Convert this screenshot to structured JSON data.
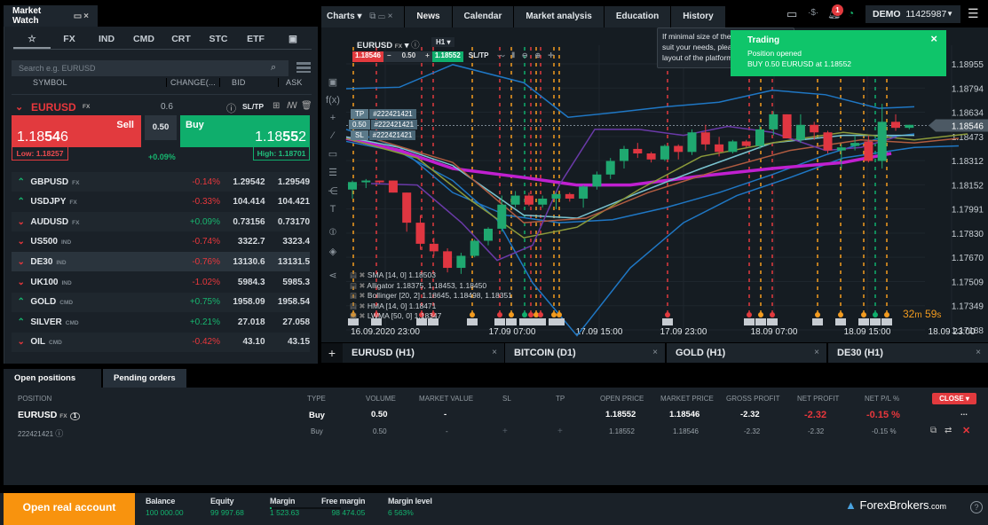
{
  "market_watch": {
    "title": "Market Watch",
    "categories": [
      "☆",
      "FX",
      "IND",
      "CMD",
      "CRT",
      "STC",
      "ETF",
      "▣"
    ],
    "search_placeholder": "Search e.g. EURUSD",
    "columns": {
      "symbol": "SYMBOL",
      "change": "CHANGE(...",
      "bid": "BID",
      "ask": "ASK"
    },
    "selected": {
      "symbol": "EURUSD",
      "tag": "FX",
      "spread": "0.6",
      "sltp": "SL/TP",
      "sell_label": "Sell",
      "sell_price_a": "1.18",
      "sell_price_b": "54",
      "sell_price_c": "6",
      "buy_label": "Buy",
      "buy_price_a": "1.18",
      "buy_price_b": "55",
      "buy_price_c": "2",
      "volume": "0.50",
      "low": "Low: 1.18257",
      "high": "High: 1.18701",
      "change": "+0.09%"
    },
    "rows": [
      {
        "dir": "up",
        "symbol": "GBPUSD",
        "tag": "FX",
        "change": "-0.14%",
        "bid": "1.29542",
        "ask": "1.29549"
      },
      {
        "dir": "up",
        "symbol": "USDJPY",
        "tag": "FX",
        "change": "-0.33%",
        "bid": "104.414",
        "ask": "104.421"
      },
      {
        "dir": "down",
        "symbol": "AUDUSD",
        "tag": "FX",
        "change": "+0.09%",
        "bid": "0.73156",
        "ask": "0.73170"
      },
      {
        "dir": "down",
        "symbol": "US500",
        "tag": "IND",
        "change": "-0.74%",
        "bid": "3322.7",
        "ask": "3323.4"
      },
      {
        "dir": "down",
        "symbol": "DE30",
        "tag": "IND",
        "change": "-0.76%",
        "bid": "13130.6",
        "ask": "13131.5"
      },
      {
        "dir": "down",
        "symbol": "UK100",
        "tag": "IND",
        "change": "-1.02%",
        "bid": "5984.3",
        "ask": "5985.3"
      },
      {
        "dir": "up",
        "symbol": "GOLD",
        "tag": "CMD",
        "change": "+0.75%",
        "bid": "1958.09",
        "ask": "1958.54"
      },
      {
        "dir": "up",
        "symbol": "SILVER",
        "tag": "CMD",
        "change": "+0.21%",
        "bid": "27.018",
        "ask": "27.058"
      },
      {
        "dir": "down",
        "symbol": "OIL",
        "tag": "CMD",
        "change": "-0.42%",
        "bid": "43.10",
        "ask": "43.15"
      }
    ]
  },
  "top_tabs": [
    "Charts",
    "News",
    "Calendar",
    "Market analysis",
    "Education",
    "History"
  ],
  "account": {
    "mode": "DEMO",
    "number": "11425987",
    "notifications": "1"
  },
  "tooltip": {
    "line1": "If minimal size of the",
    "line2": "suit your needs, pleas",
    "line3": "layout of the platform"
  },
  "notification": {
    "title": "Trading",
    "line1": "Position opened",
    "line2": "BUY 0.50 EURUSD at 1.18552",
    "close": "×"
  },
  "chart_toolbar": {
    "symbol": "EURUSD",
    "tag": "FX",
    "timeframe": "H1",
    "sell": "1.18546",
    "volume": "0.50",
    "buy": "1.18552",
    "sltp": "SL/TP"
  },
  "order_labels": {
    "tp": "TP",
    "sl": "SL",
    "volume": "0.50",
    "id": "#222421421"
  },
  "indicators": [
    "SMA [14, 0] 1.18503",
    "Alligator 1.18375, 1.18453, 1.18450",
    "Bollinger [20, 2] 1.18645, 1.18498, 1.18351",
    "HMA [14, 0] 1.18471",
    "LWMA [50, 0] 1.18347"
  ],
  "countdown": {
    "min": "32",
    "min_unit": "m",
    "sec": "59",
    "sec_unit": "s"
  },
  "chart_data": {
    "type": "candlestick",
    "symbol": "EURUSD",
    "timeframe": "H1",
    "y_ticks": [
      "1.18955",
      "1.18794",
      "1.18634",
      "1.18473",
      "1.18312",
      "1.18152",
      "1.17991",
      "1.17830",
      "1.17670",
      "1.17509",
      "1.17349",
      "1.17188"
    ],
    "ylim": [
      1.17188,
      1.18955
    ],
    "current_price": "1.18546",
    "x_ticks": [
      "16.09.2020 23:00",
      "17.09 07:00",
      "17.09 15:00",
      "17.09 23:00",
      "18.09 07:00",
      "18.09 15:00",
      "18.09 23:00"
    ],
    "candles": [
      [
        1.1812,
        1.1818,
        1.1806,
        1.1817
      ],
      [
        1.1818,
        1.1819,
        1.1813,
        1.1818
      ],
      [
        1.1818,
        1.1818,
        1.1816,
        1.1817
      ],
      [
        1.1818,
        1.1818,
        1.181,
        1.181
      ],
      [
        1.181,
        1.181,
        1.1784,
        1.179
      ],
      [
        1.179,
        1.1795,
        1.1772,
        1.1776
      ],
      [
        1.1776,
        1.178,
        1.1768,
        1.1771
      ],
      [
        1.1771,
        1.1773,
        1.1757,
        1.176
      ],
      [
        1.176,
        1.177,
        1.1756,
        1.1768
      ],
      [
        1.1768,
        1.1779,
        1.1767,
        1.1778
      ],
      [
        1.1778,
        1.1787,
        1.1775,
        1.1786
      ],
      [
        1.1786,
        1.1808,
        1.1784,
        1.1802
      ],
      [
        1.1802,
        1.1811,
        1.18,
        1.1808
      ],
      [
        1.1808,
        1.181,
        1.1801,
        1.1802
      ],
      [
        1.1802,
        1.1808,
        1.18,
        1.1806
      ],
      [
        1.1806,
        1.181,
        1.1799,
        1.1809
      ],
      [
        1.1809,
        1.181,
        1.1804,
        1.1806
      ],
      [
        1.1806,
        1.1815,
        1.18,
        1.1814
      ],
      [
        1.1814,
        1.1824,
        1.1812,
        1.1822
      ],
      [
        1.1822,
        1.1833,
        1.1819,
        1.1831
      ],
      [
        1.1831,
        1.1841,
        1.1826,
        1.1839
      ],
      [
        1.1839,
        1.1843,
        1.1833,
        1.1836
      ],
      [
        1.1836,
        1.1837,
        1.183,
        1.1832
      ],
      [
        1.1832,
        1.1842,
        1.1831,
        1.1841
      ],
      [
        1.1841,
        1.1842,
        1.1832,
        1.1837
      ],
      [
        1.1837,
        1.1852,
        1.1835,
        1.185
      ],
      [
        1.185,
        1.1855,
        1.1838,
        1.1842
      ],
      [
        1.1842,
        1.1847,
        1.1834,
        1.1837
      ],
      [
        1.1837,
        1.1845,
        1.1836,
        1.1844
      ],
      [
        1.1844,
        1.1845,
        1.184,
        1.1841
      ],
      [
        1.1841,
        1.1855,
        1.1839,
        1.1852
      ],
      [
        1.1852,
        1.1864,
        1.1848,
        1.1862
      ],
      [
        1.1862,
        1.1862,
        1.1846,
        1.1846
      ],
      [
        1.1845,
        1.1862,
        1.1843,
        1.1855
      ],
      [
        1.1855,
        1.1857,
        1.1845,
        1.185
      ],
      [
        1.185,
        1.1851,
        1.1836,
        1.1838
      ],
      [
        1.1838,
        1.1842,
        1.1826,
        1.184
      ],
      [
        1.1841,
        1.1848,
        1.1838,
        1.1843
      ],
      [
        1.1844,
        1.1848,
        1.183,
        1.1831
      ],
      [
        1.1831,
        1.1869,
        1.1826,
        1.1857
      ],
      [
        1.1857,
        1.1862,
        1.1851,
        1.1853
      ],
      [
        1.1853,
        1.1855,
        1.1852,
        1.1855
      ]
    ]
  },
  "chart_tabs": [
    {
      "label": "EURUSD (H1)"
    },
    {
      "label": "BITCOIN (D1)"
    },
    {
      "label": "GOLD (H1)"
    },
    {
      "label": "DE30 (H1)"
    }
  ],
  "positions": {
    "tab_open": "Open positions",
    "tab_pending": "Pending orders",
    "headers": {
      "position": "POSITION",
      "type": "TYPE",
      "volume": "VOLUME",
      "market_value": "MARKET VALUE",
      "sl": "SL",
      "tp": "TP",
      "open_price": "OPEN PRICE",
      "market_price": "MARKET PRICE",
      "gross_profit": "GROSS PROFIT",
      "net_profit": "NET PROFIT",
      "net_pl": "NET P/L %"
    },
    "close_label": "CLOSE",
    "summary": {
      "symbol": "EURUSD",
      "tag": "FX",
      "count": "1",
      "type": "Buy",
      "volume": "0.50",
      "market_value": "-",
      "open_price": "1.18552",
      "market_price": "1.18546",
      "gross_profit": "-2.32",
      "net_profit": "-2.32",
      "net_pl": "-0.15 %",
      "more": "..."
    },
    "detail": {
      "id": "222421421",
      "type": "Buy",
      "volume": "0.50",
      "market_value": "-",
      "sl": "+",
      "tp": "+",
      "open_price": "1.18552",
      "market_price": "1.18546",
      "gross_profit": "-2.32",
      "net_profit": "-2.32",
      "net_pl": "-0.15 %"
    }
  },
  "footer": {
    "open_real": "Open real account",
    "stats": [
      {
        "label": "Balance",
        "value": "100 000.00"
      },
      {
        "label": "Equity",
        "value": "99 997.68"
      },
      {
        "label": "Margin",
        "value": "1 523.63"
      },
      {
        "label": "Free margin",
        "value": "98 474.05"
      },
      {
        "label": "Margin level",
        "value": "6 563%"
      }
    ],
    "watermark": "ForexBrokers",
    "watermark_suffix": ".com"
  }
}
